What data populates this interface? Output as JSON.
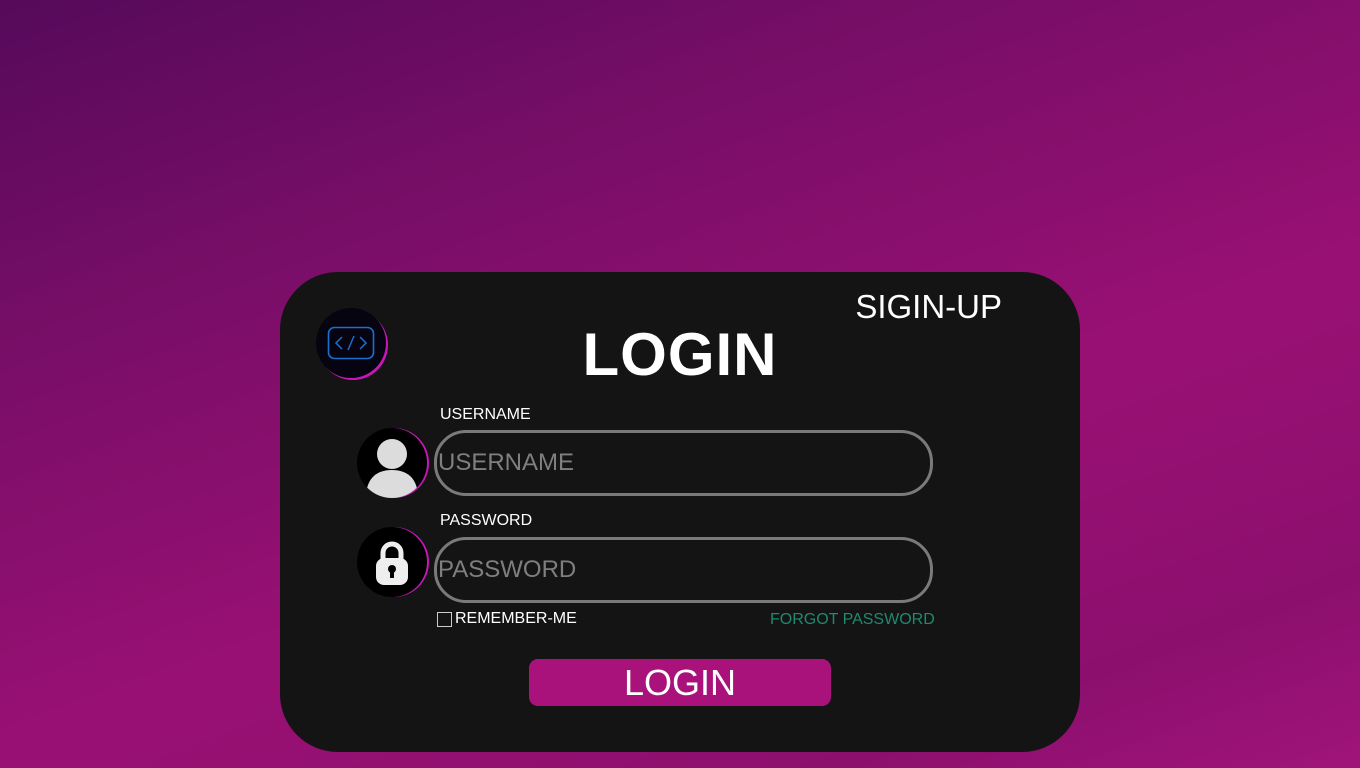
{
  "header": {
    "logo_icon": "code-brackets-icon",
    "signup_label": "SIGIN-UP",
    "title": "LOGIN"
  },
  "form": {
    "username": {
      "label": "USERNAME",
      "placeholder": "USERNAME",
      "value": "",
      "icon": "user-icon"
    },
    "password": {
      "label": "PASSWORD",
      "placeholder": "PASSWORD",
      "value": "",
      "icon": "lock-icon"
    },
    "remember_label": "REMEMBER-ME",
    "remember_checked": false,
    "forgot_label": "FORGOT PASSWORD",
    "submit_label": "LOGIN"
  },
  "colors": {
    "card_bg": "#141414",
    "accent": "#a8127a",
    "forgot_link": "#1e8a6e",
    "logo_glyph": "#1a6fd0"
  }
}
